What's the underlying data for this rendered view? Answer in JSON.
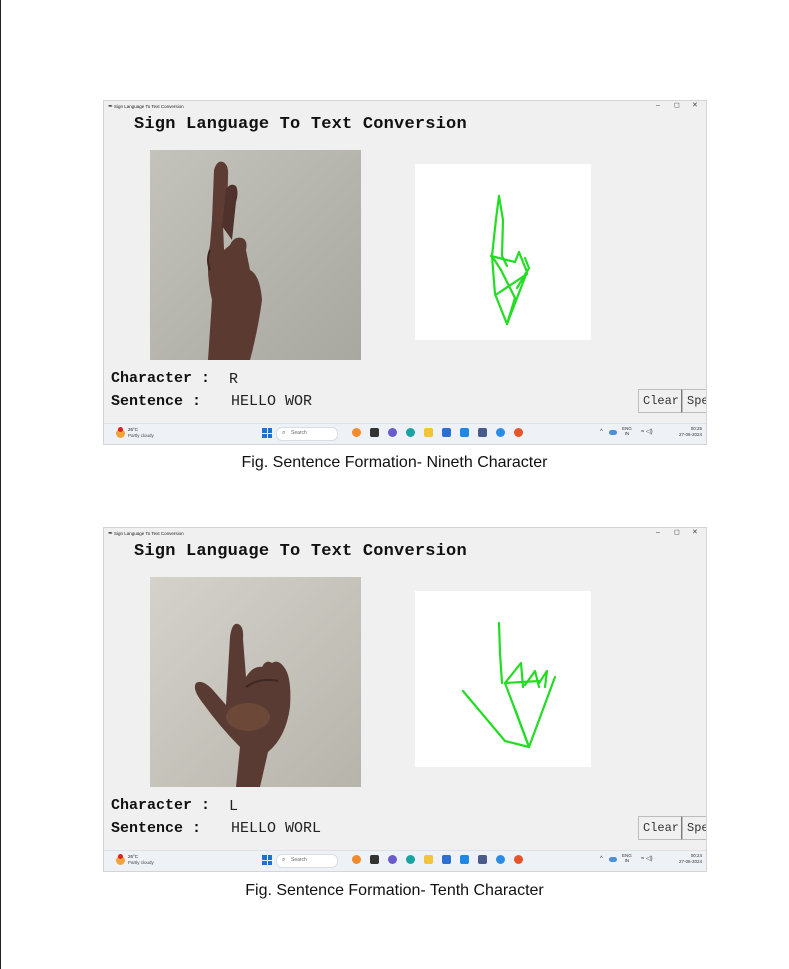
{
  "figures": [
    {
      "window_title": "Sign Language To Text Conversion",
      "app_title": "Sign Language To Text Conversion",
      "character_label": "Character :",
      "character_value": "R",
      "sentence_label": "Sentence :",
      "sentence_value": "HELLO WOR",
      "buttons": {
        "clear": "Clear",
        "speak": "Spe"
      },
      "taskbar": {
        "temperature": "26°C",
        "weather": "Partly cloudy",
        "search_placeholder": "Search",
        "lang_1": "ENG",
        "lang_2": "IN",
        "time": "00:25",
        "date": "27-06-2024"
      },
      "caption": "Fig. Sentence Formation- Nineth Character"
    },
    {
      "window_title": "Sign Language To Text Conversion",
      "app_title": "Sign Language To Text Conversion",
      "character_label": "Character :",
      "character_value": "L",
      "sentence_label": "Sentence :",
      "sentence_value": "HELLO WORL",
      "buttons": {
        "clear": "Clear",
        "speak": "Spe"
      },
      "taskbar": {
        "temperature": "26°C",
        "weather": "Partly cloudy",
        "search_placeholder": "Search",
        "lang_1": "ENG",
        "lang_2": "IN",
        "time": "00:24",
        "date": "27-06-2024"
      },
      "caption": "Fig. Sentence Formation- Tenth Character"
    }
  ],
  "colors": {
    "skeleton": "#22dd22",
    "wall": "#b9b8b1",
    "skin": "#5b3a31",
    "start_blue": "#1a74d8"
  },
  "icons": [
    "app-feather-icon",
    "minimize-icon",
    "maximize-icon",
    "close-icon",
    "weather-icon",
    "windows-start-icon",
    "search-icon",
    "network-icon",
    "volume-icon"
  ]
}
